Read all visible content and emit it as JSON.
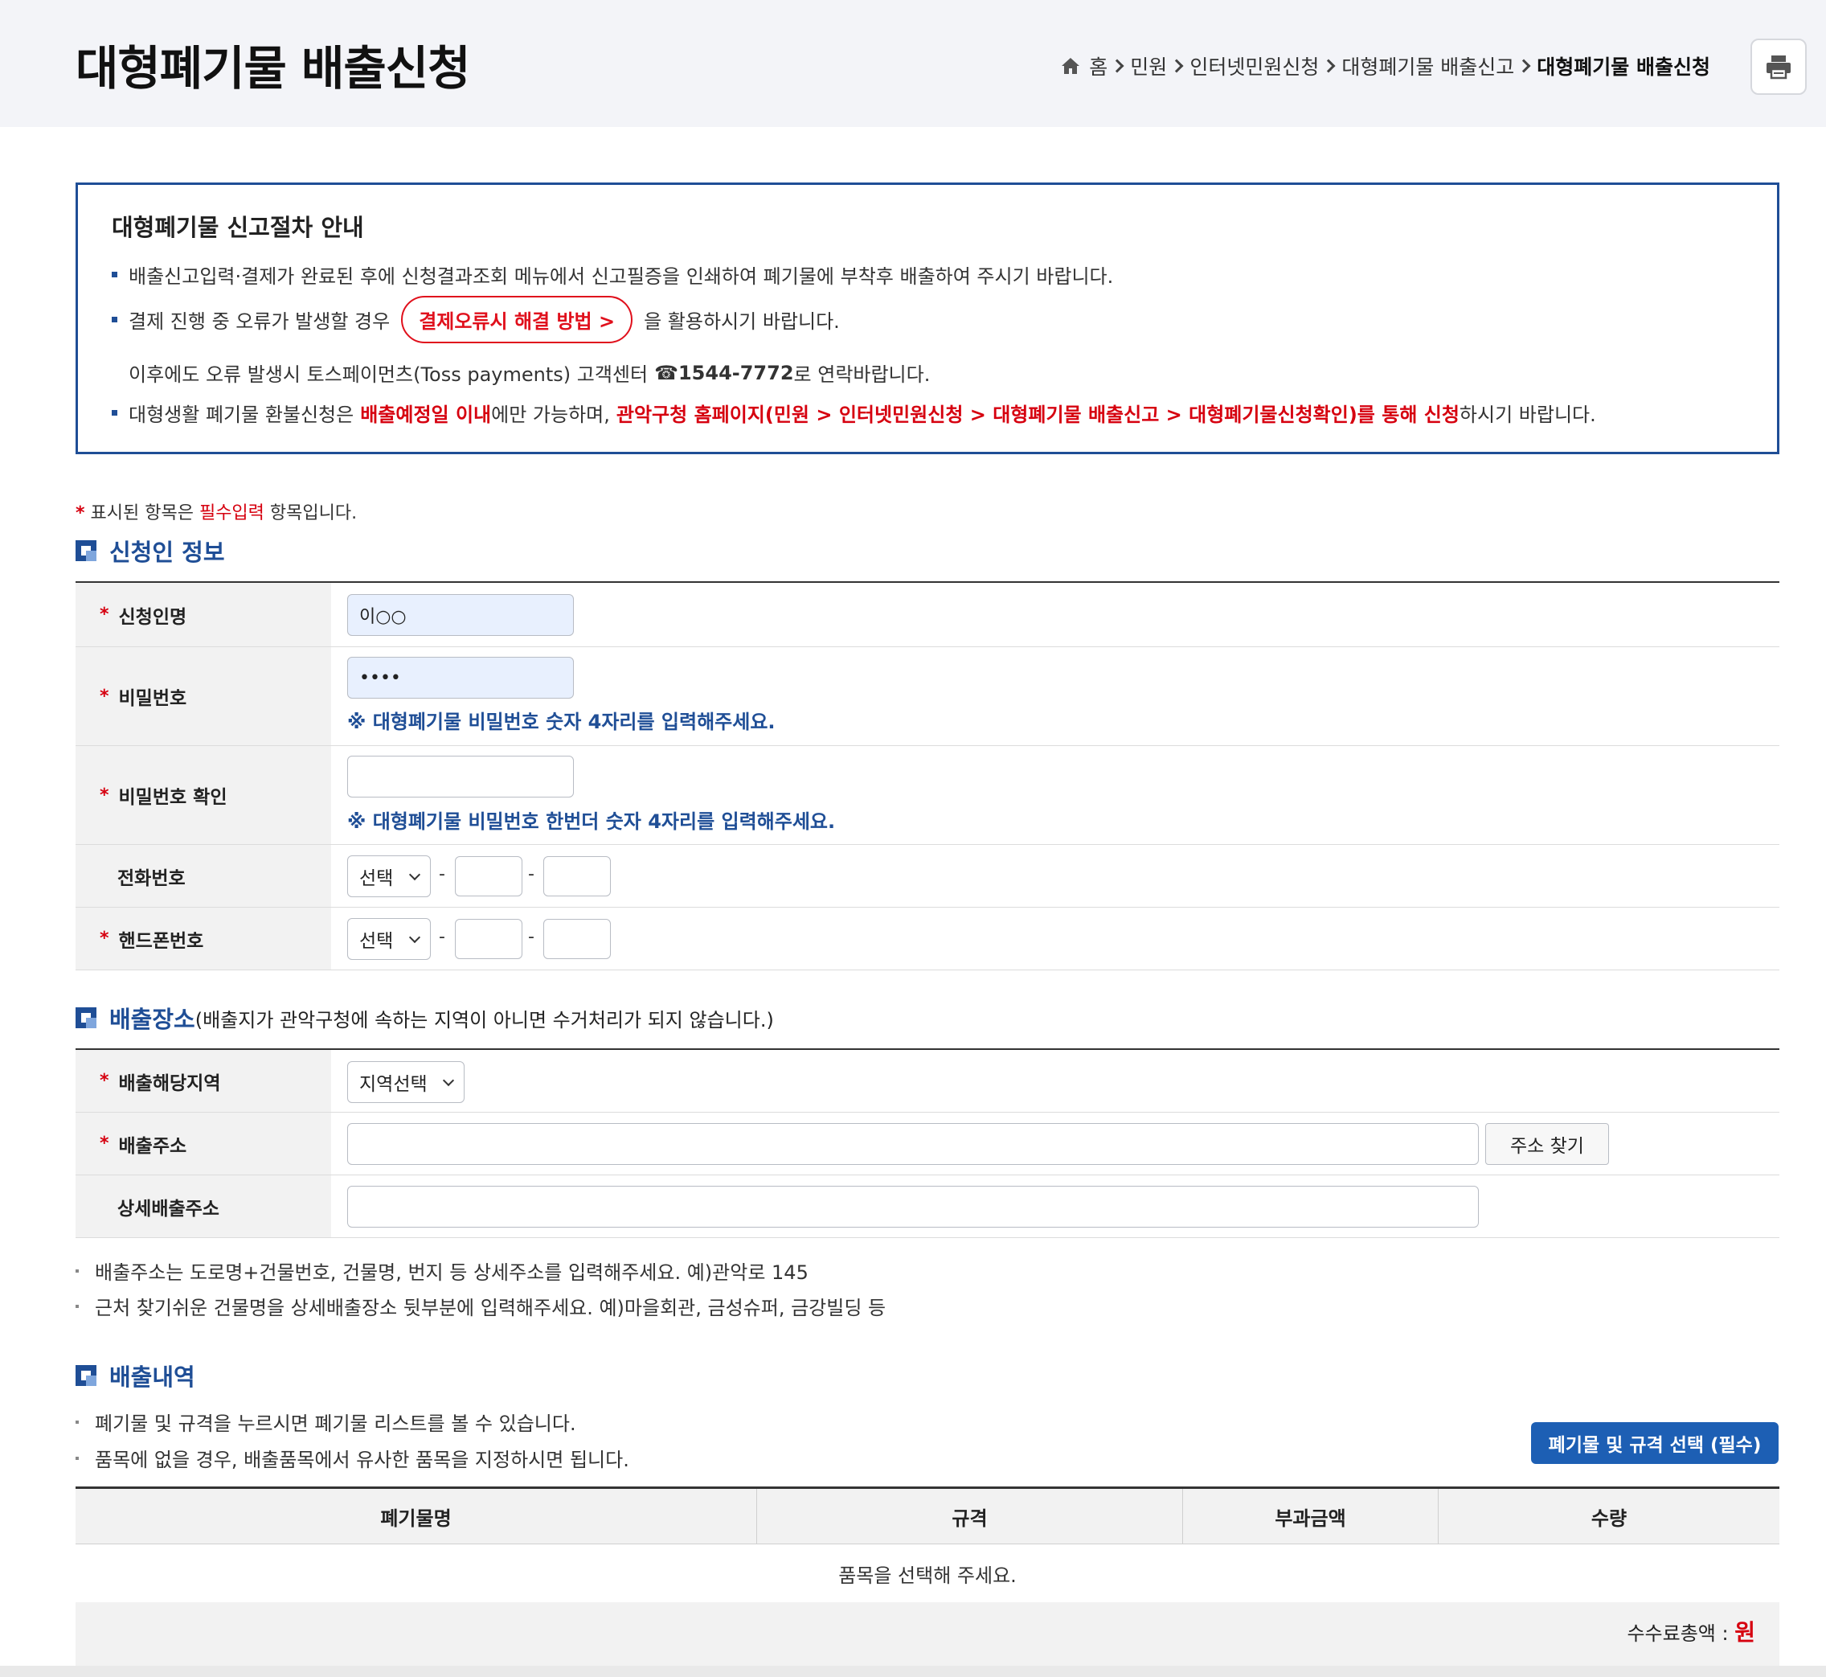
{
  "header": {
    "title": "대형폐기물 배출신청",
    "breadcrumb": [
      "홈",
      "민원",
      "인터넷민원신청",
      "대형폐기물 배출신고",
      "대형폐기물 배출신청"
    ],
    "print_icon": "printer-icon"
  },
  "notice": {
    "title": "대형폐기물 신고절차 안내",
    "line1": "배출신고입력·결제가 완료된 후에 신청결과조회 메뉴에서 신고필증을 인쇄하여 폐기물에 부착후 배출하여 주시기 바랍니다.",
    "line2_pre": "결제 진행 중 오류가 발생할 경우",
    "line2_button": "결제오류시 해결 방법 >",
    "line2_post": "을 활용하시기 바랍니다.",
    "line3_pre": "이후에도 오류 발생시 토스페이먼츠(Toss payments) 고객센터",
    "line3_phone": "☎1544-7772",
    "line3_post": "로 연락바랍니다.",
    "line4_a": "대형생활 폐기물 환불신청은",
    "line4_b": "배출예정일 이내",
    "line4_c": "에만 가능하며,",
    "line4_d": "관악구청 홈페이지(민원 > 인터넷민원신청 > 대형폐기물 배출신고 > 대형폐기물신청확인)를 통해 신청",
    "line4_e": "하시기 바랍니다."
  },
  "required_note": {
    "star": "*",
    "pre": "표시된 항목은",
    "red": "필수입력",
    "post": "항목입니다."
  },
  "applicant": {
    "section_title": "신청인 정보",
    "name_label": "신청인명",
    "name_value": "이○○",
    "password_label": "비밀번호",
    "password_value": "••••",
    "password_help": "※ 대형폐기물 비밀번호 숫자 4자리를 입력해주세요.",
    "password_confirm_label": "비밀번호 확인",
    "password_confirm_help": "※ 대형폐기물 비밀번호 한번더 숫자 4자리를 입력해주세요.",
    "phone_label": "전화번호",
    "phone_select": "선택",
    "mobile_label": "핸드폰번호",
    "mobile_select": "선택",
    "dash": "-"
  },
  "location": {
    "section_title": "배출장소",
    "section_sub": "(배출지가 관악구청에 속하는 지역이 아니면 수거처리가 되지 않습니다.)",
    "region_label": "배출해당지역",
    "region_select": "지역선택",
    "address_label": "배출주소",
    "address_button": "주소 찾기",
    "detail_label": "상세배출주소",
    "tip1": "배출주소는 도로명+건물번호, 건물명, 번지 등 상세주소를 입력해주세요. 예)관악로 145",
    "tip2": "근처 찾기쉬운 건물명을 상세배출장소 뒷부분에 입력해주세요. 예)마을회관, 금성슈퍼, 금강빌딩 등"
  },
  "items": {
    "section_title": "배출내역",
    "tip1": "폐기물 및 규격을 누르시면 폐기물 리스트를 볼 수 있습니다.",
    "tip2": "품목에 없을 경우, 배출품목에서 유사한 품목을 지정하시면 됩니다.",
    "select_button": "폐기물 및 규격 선택 (필수)",
    "columns": [
      "폐기물명",
      "규격",
      "부과금액",
      "수량"
    ],
    "empty": "품목을 선택해 주세요.",
    "total_label": "수수료총액 :",
    "total_unit": "원"
  },
  "colors": {
    "accent": "#1f4e96",
    "required_red": "#d6000f",
    "button_blue": "#1d5fb4",
    "autofill_bg": "#e8f0fe"
  }
}
